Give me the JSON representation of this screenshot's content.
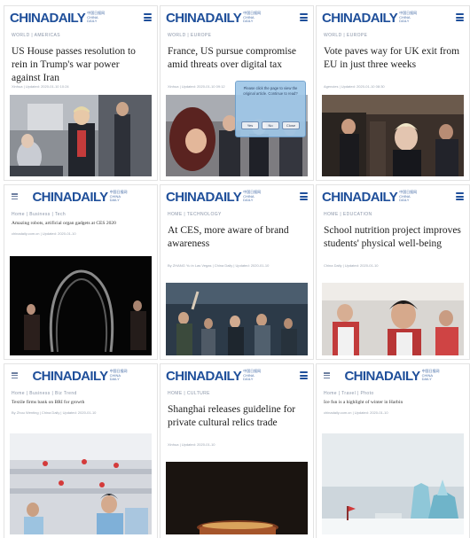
{
  "tiles": [
    {
      "logo_a": "CHINA",
      "logo_b": "DAILY",
      "logo_sub": "中国日报网 CHINA DAILY",
      "breadcrumb": "WORLD | AMERICAS",
      "headline": "US House passes resolution to rein in Trump's war power against Iran",
      "meta": "Xinhua | Updated: 2020-01-10 10:24"
    },
    {
      "logo_a": "CHINA",
      "logo_b": "DAILY",
      "logo_sub": "中国日报网 CHINA DAILY",
      "breadcrumb": "WORLD | EUROPE",
      "headline": "France, US pursue compromise amid threats over digital tax",
      "meta": "Xinhua | Updated: 2020-01-10 09:12",
      "popup": {
        "text": "Please click the page to view the original article. Continue to read?",
        "yes": "Yes",
        "no": "No",
        "cancel": "Close"
      }
    },
    {
      "logo_a": "CHINA",
      "logo_b": "DAILY",
      "logo_sub": "中国日报网 CHINA DAILY",
      "breadcrumb": "WORLD | EUROPE",
      "headline": "Vote paves way for UK exit from EU in just three weeks",
      "meta": "Agencies | Updated: 2020-01-10 08:30"
    },
    {
      "logo_a": "CHINA",
      "logo_b": "DAILY",
      "logo_sub": "中国日报网 CHINA DAILY",
      "breadcrumb": "Home | Business | Tech",
      "headline": "Amazing robots, artificial organ gadgets at CES 2020",
      "meta": "chinadaily.com.cn | Updated: 2020-01-10"
    },
    {
      "logo_a": "CHINA",
      "logo_b": "DAILY",
      "logo_sub": "中国日报网 CHINA DAILY",
      "breadcrumb": "HOME | TECHNOLOGY",
      "headline": "At CES, more aware of brand awareness",
      "meta": "By ZHANG Yu in Las Vegas | China Daily | Updated: 2020-01-10"
    },
    {
      "logo_a": "CHINA",
      "logo_b": "DAILY",
      "logo_sub": "中国日报网 CHINA DAILY",
      "breadcrumb": "HOME | EDUCATION",
      "headline": "School nutrition project improves students' physical well-being",
      "meta": "China Daily | Updated: 2020-01-10"
    },
    {
      "logo_a": "CHINA",
      "logo_b": "DAILY",
      "logo_sub": "中国日报网 CHINA DAILY",
      "breadcrumb": "Home | Business | Biz Trend",
      "headline": "Textile firms bank on BRI for growth",
      "meta": "By Zhou Wenting | China Daily | Updated: 2020-01-10"
    },
    {
      "logo_a": "CHINA",
      "logo_b": "DAILY",
      "logo_sub": "中国日报网 CHINA DAILY",
      "breadcrumb": "HOME | CULTURE",
      "headline": "Shanghai releases guideline for private cultural relics trade",
      "meta": "Xinhua | Updated: 2020-01-10"
    },
    {
      "logo_a": "CHINA",
      "logo_b": "DAILY",
      "logo_sub": "中国日报网 CHINA DAILY",
      "breadcrumb": "Home | Travel | Photo",
      "headline": "Ice fun is a highlight of winter in Harbin",
      "meta": "chinadaily.com.cn | Updated: 2020-01-10"
    }
  ]
}
